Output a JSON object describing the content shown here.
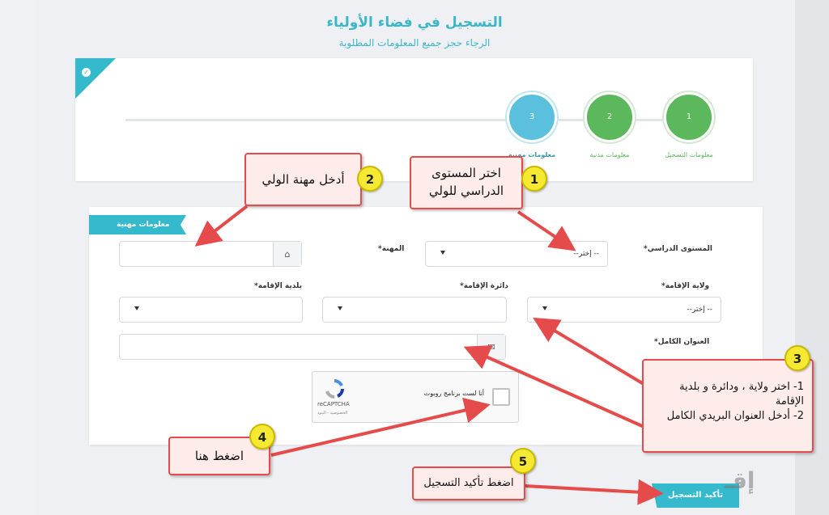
{
  "header": {
    "title": "التسجيل في فضاء الأولياء",
    "subtitle": "الرجاء حجز جميع المعلومات المطلوبة"
  },
  "steps": [
    {
      "number": "1",
      "label": "معلومات التسجيل"
    },
    {
      "number": "2",
      "label": "معلومات مدنية"
    },
    {
      "number": "3",
      "label": "معلومات مهنية"
    }
  ],
  "section": {
    "title": "معلومات مهنية"
  },
  "form": {
    "education_label": "المستوى الدراسي*",
    "education_value": "--إختر --",
    "profession_label": "المهنة*",
    "wilaya_label": "ولاية الإقامة*",
    "wilaya_value": "--إختر --",
    "daira_label": "دائرة الإقامة*",
    "commune_label": "بلدية الإقامة*",
    "address_label": "العنوان الكامل*"
  },
  "captcha": {
    "text": "أنا لست برنامج روبوت",
    "brand": "reCAPTCHA",
    "privacy": "الخصوصية - البنود"
  },
  "submit_label": "تأكيد التسجيل",
  "annotations": [
    {
      "number": "1",
      "text": "اختر المستوى الدراسي للولي"
    },
    {
      "number": "2",
      "text": "أدخل مهنة الولي"
    },
    {
      "number": "3",
      "line1": "1- اختر ولاية ، ودائرة و بلدية الإقامة",
      "line2": "2- أدخل العنوان البريدي الكامل"
    },
    {
      "number": "4",
      "text": "اضغط هنا"
    },
    {
      "number": "5",
      "text": "اضغط تأكيد التسجيل"
    }
  ],
  "colors": {
    "accent": "#35b9cc",
    "step_done": "#5cb85c",
    "callout_border": "#e54b4b",
    "badge": "#f5e932"
  }
}
